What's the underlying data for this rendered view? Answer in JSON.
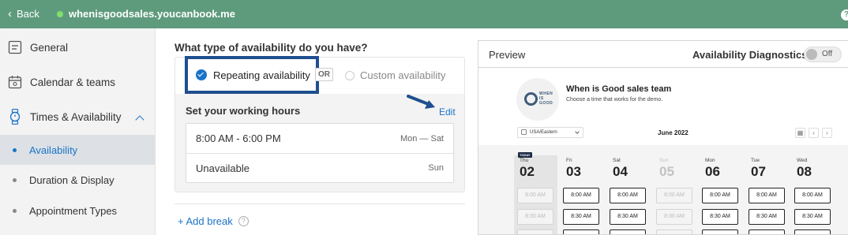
{
  "topbar": {
    "back_label": "Back",
    "site": "whenisgoodsales.youcanbook.me",
    "help_icon": "?"
  },
  "sidebar": {
    "items": [
      {
        "label": "General",
        "icon": "document-icon"
      },
      {
        "label": "Calendar & teams",
        "icon": "calendar-icon"
      },
      {
        "label": "Times & Availability",
        "icon": "watch-icon",
        "expanded": true
      }
    ],
    "subitems": [
      {
        "label": "Availability",
        "active": true
      },
      {
        "label": "Duration & Display",
        "active": false
      },
      {
        "label": "Appointment Types",
        "active": false
      }
    ]
  },
  "main": {
    "question": "What type of availability do you have?",
    "option_repeating": "Repeating availability",
    "or_label": "OR",
    "option_custom": "Custom availability",
    "hours_title": "Set your working hours",
    "edit_label": "Edit",
    "hours": [
      {
        "time": "8:00 AM - 6:00 PM",
        "days": "Mon — Sat"
      },
      {
        "time": "Unavailable",
        "days": "Sun"
      }
    ],
    "add_break": "+ Add break",
    "help_glyph": "?"
  },
  "preview": {
    "label": "Preview",
    "diagnostics_label": "Availability Diagnostics",
    "toggle_label": "Off",
    "toggle_on": false,
    "logo_text": [
      "WHEN",
      "IS",
      "GOOD"
    ],
    "team_name": "When is Good sales team",
    "team_subtitle": "Choose a time that works for the demo.",
    "timezone": "USA/Eastern",
    "month": "June 2022",
    "today_badge": "TODAY",
    "days": [
      {
        "dow": "Thu",
        "num": "02",
        "today": true,
        "slots": [
          "8:00 AM",
          "8:30 AM"
        ],
        "available": false
      },
      {
        "dow": "Fri",
        "num": "03",
        "slots": [
          "8:00 AM",
          "8:30 AM"
        ],
        "available": true
      },
      {
        "dow": "Sat",
        "num": "04",
        "slots": [
          "8:00 AM",
          "8:30 AM"
        ],
        "available": true
      },
      {
        "dow": "Sun",
        "num": "05",
        "slots": [
          "8:00 AM",
          "8:30 AM"
        ],
        "available": false,
        "dim": true
      },
      {
        "dow": "Mon",
        "num": "06",
        "slots": [
          "8:00 AM",
          "8:30 AM"
        ],
        "available": true
      },
      {
        "dow": "Tue",
        "num": "07",
        "slots": [
          "8:00 AM",
          "8:30 AM"
        ],
        "available": true
      },
      {
        "dow": "Wed",
        "num": "08",
        "slots": [
          "8:00 AM",
          "8:30 AM"
        ],
        "available": true
      }
    ]
  },
  "colors": {
    "topbar": "#5e9b7c",
    "accent": "#1a73c8",
    "highlight_box": "#1e4f8f"
  }
}
